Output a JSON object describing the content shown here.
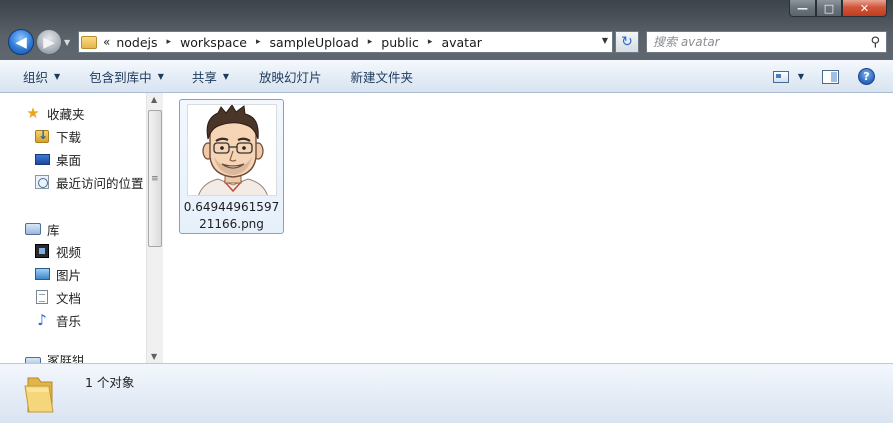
{
  "window": {
    "controls": {
      "minimize": "—",
      "maximize": "□",
      "close": "✕"
    }
  },
  "nav": {
    "back_icon": "arrow-left-icon",
    "forward_icon": "arrow-right-icon"
  },
  "address": {
    "overflow": "«",
    "crumbs": [
      "nodejs",
      "workspace",
      "sampleUpload",
      "public",
      "avatar"
    ],
    "separator": "▸",
    "dropdown": "▾"
  },
  "search": {
    "placeholder": "搜索 avatar"
  },
  "toolbar": {
    "organize": "组织",
    "include_in_library": "包含到库中",
    "share": "共享",
    "slideshow": "放映幻灯片",
    "new_folder": "新建文件夹",
    "help": "?"
  },
  "sidebar": {
    "favorites": {
      "label": "收藏夹",
      "items": [
        {
          "label": "下载",
          "icon": "downloads-icon"
        },
        {
          "label": "桌面",
          "icon": "desktop-icon"
        },
        {
          "label": "最近访问的位置",
          "icon": "recent-places-icon"
        }
      ]
    },
    "libraries": {
      "label": "库",
      "items": [
        {
          "label": "视频",
          "icon": "video-library-icon"
        },
        {
          "label": "图片",
          "icon": "pictures-library-icon"
        },
        {
          "label": "文档",
          "icon": "documents-library-icon"
        },
        {
          "label": "音乐",
          "icon": "music-library-icon"
        }
      ]
    },
    "partial_item": "家庭组"
  },
  "files": [
    {
      "name": "0.6494496159721166.png",
      "name_line1": "0.64944961597",
      "name_line2": "21166.png",
      "thumbnail": "cartoon-avatar-image"
    }
  ],
  "status": {
    "text": "1 个对象"
  },
  "colors": {
    "commandbar": "#dfe8f3",
    "command_text": "#1e395b",
    "selection_border": "#7da2ce",
    "close_button": "#c23c1f"
  }
}
